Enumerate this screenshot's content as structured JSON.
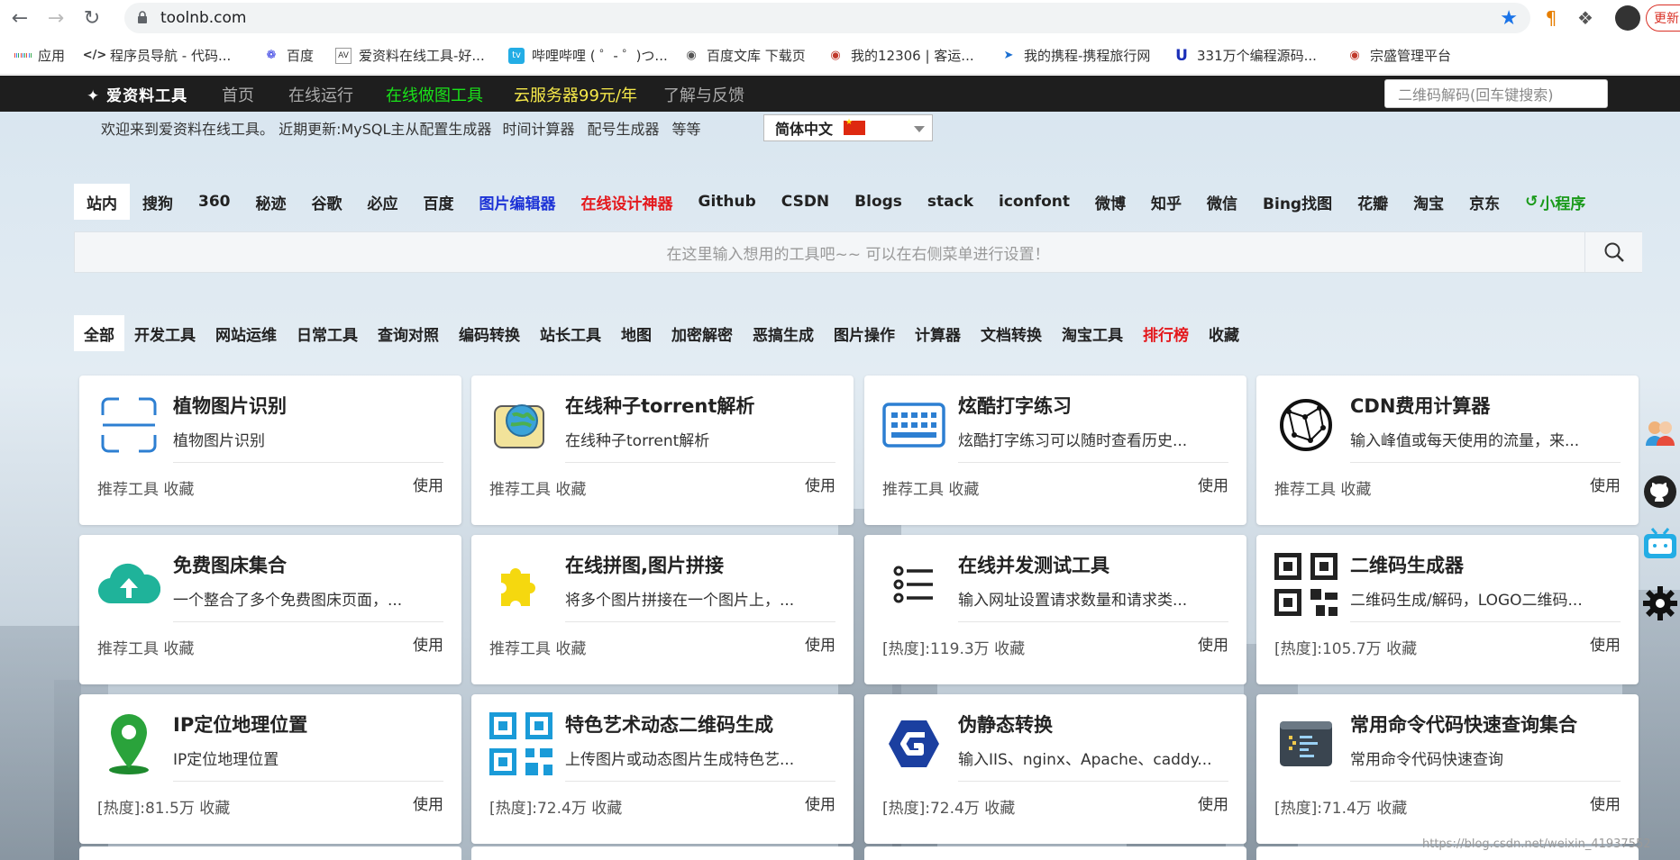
{
  "browser": {
    "url": "toolnb.com",
    "update_label": "更新"
  },
  "bookmarks": [
    {
      "label": "应用",
      "icon": "apps-grid-icon"
    },
    {
      "label": "程序员导航 - 代码...",
      "icon": "code-icon"
    },
    {
      "label": "百度",
      "icon": "baidu-paw-icon"
    },
    {
      "label": "爱资料在线工具-好...",
      "icon": "toolnb-icon"
    },
    {
      "label": "哔哩哔哩 ( ゜- ゜)つ...",
      "icon": "bilibili-icon"
    },
    {
      "label": "百度文库 下载页",
      "icon": "globe-icon"
    },
    {
      "label": "我的12306 | 客运...",
      "icon": "train-icon"
    },
    {
      "label": "我的携程-携程旅行网",
      "icon": "ctrip-icon"
    },
    {
      "label": "331万个编程源码...",
      "icon": "u-icon"
    },
    {
      "label": "宗盛管理平台",
      "icon": "platform-icon"
    }
  ],
  "site_header": {
    "logo": "爱资料工具",
    "nav": [
      {
        "label": "首页",
        "style": "normal"
      },
      {
        "label": "在线运行",
        "style": "normal"
      },
      {
        "label": "在线做图工具",
        "style": "green"
      },
      {
        "label": "云服务器99元/年",
        "style": "yellow"
      },
      {
        "label": "了解与反馈",
        "style": "normal"
      }
    ],
    "search_placeholder": "二维码解码(回车键搜索)"
  },
  "welcome": {
    "text": "欢迎来到爱资料在线工具。 近期更新: ",
    "updates": [
      "MySQL主从配置生成器",
      "时间计算器",
      "配号生成器",
      "等等"
    ],
    "language": "简体中文"
  },
  "engine_tabs": [
    {
      "label": "站内",
      "style": "active"
    },
    {
      "label": "搜狗",
      "style": "normal"
    },
    {
      "label": "360",
      "style": "normal"
    },
    {
      "label": "秘迹",
      "style": "normal"
    },
    {
      "label": "谷歌",
      "style": "normal"
    },
    {
      "label": "必应",
      "style": "normal"
    },
    {
      "label": "百度",
      "style": "normal"
    },
    {
      "label": "图片编辑器",
      "style": "blue"
    },
    {
      "label": "在线设计神器",
      "style": "red"
    },
    {
      "label": "Github",
      "style": "normal"
    },
    {
      "label": "CSDN",
      "style": "normal"
    },
    {
      "label": "Blogs",
      "style": "normal"
    },
    {
      "label": "stack",
      "style": "normal"
    },
    {
      "label": "iconfont",
      "style": "normal"
    },
    {
      "label": "微博",
      "style": "normal"
    },
    {
      "label": "知乎",
      "style": "normal"
    },
    {
      "label": "微信",
      "style": "normal"
    },
    {
      "label": "Bing找图",
      "style": "normal"
    },
    {
      "label": "花瓣",
      "style": "normal"
    },
    {
      "label": "淘宝",
      "style": "normal"
    },
    {
      "label": "京东",
      "style": "normal"
    },
    {
      "label": "小程序",
      "style": "green"
    }
  ],
  "main_search": {
    "placeholder": "在这里输入想用的工具吧~~ 可以在右侧菜单进行设置！"
  },
  "category_tabs": [
    {
      "label": "全部",
      "style": "active"
    },
    {
      "label": "开发工具",
      "style": "normal"
    },
    {
      "label": "网站运维",
      "style": "normal"
    },
    {
      "label": "日常工具",
      "style": "normal"
    },
    {
      "label": "查询对照",
      "style": "normal"
    },
    {
      "label": "编码转换",
      "style": "normal"
    },
    {
      "label": "站长工具",
      "style": "normal"
    },
    {
      "label": "地图",
      "style": "normal"
    },
    {
      "label": "加密解密",
      "style": "normal"
    },
    {
      "label": "恶搞生成",
      "style": "normal"
    },
    {
      "label": "图片操作",
      "style": "normal"
    },
    {
      "label": "计算器",
      "style": "normal"
    },
    {
      "label": "文档转换",
      "style": "normal"
    },
    {
      "label": "淘宝工具",
      "style": "normal"
    },
    {
      "label": "排行榜",
      "style": "red"
    },
    {
      "label": "收藏",
      "style": "normal"
    }
  ],
  "cards": [
    {
      "title": "植物图片识别",
      "desc": "植物图片识别",
      "meta": "推荐工具 收藏",
      "use": "使用",
      "icon": "scan-frame-icon"
    },
    {
      "title": "在线种子torrent解析",
      "desc": "在线种子torrent解析",
      "meta": "推荐工具 收藏",
      "use": "使用",
      "icon": "torrent-globe-icon"
    },
    {
      "title": "炫酷打字练习",
      "desc": "炫酷打字练习可以随时查看历史...",
      "meta": "推荐工具 收藏",
      "use": "使用",
      "icon": "keyboard-icon"
    },
    {
      "title": "CDN费用计算器",
      "desc": "输入峰值或每天使用的流量，来...",
      "meta": "推荐工具 收藏",
      "use": "使用",
      "icon": "network-globe-icon"
    },
    {
      "title": "免费图床集合",
      "desc": "一个整合了多个免费图床页面，...",
      "meta": "推荐工具 收藏",
      "use": "使用",
      "icon": "cloud-upload-icon"
    },
    {
      "title": "在线拼图,图片拼接",
      "desc": "将多个图片拼接在一个图片上，...",
      "meta": "推荐工具 收藏",
      "use": "使用",
      "icon": "puzzle-icon"
    },
    {
      "title": "在线并发测试工具",
      "desc": "输入网址设置请求数量和请求类...",
      "meta": "[热度]:119.3万 收藏",
      "use": "使用",
      "icon": "list-icon"
    },
    {
      "title": "二维码生成器",
      "desc": "二维码生成/解码，LOGO二维码...",
      "meta": "[热度]:105.7万 收藏",
      "use": "使用",
      "icon": "qrcode-icon"
    },
    {
      "title": "IP定位地理位置",
      "desc": "IP定位地理位置",
      "meta": "[热度]:81.5万 收藏",
      "use": "使用",
      "icon": "map-pin-icon"
    },
    {
      "title": "特色艺术动态二维码生成",
      "desc": "上传图片或动态图片生成特色艺...",
      "meta": "[热度]:72.4万 收藏",
      "use": "使用",
      "icon": "art-qrcode-icon"
    },
    {
      "title": "伪静态转换",
      "desc": "输入IIS、nginx、Apache、caddy...",
      "meta": "[热度]:72.4万 收藏",
      "use": "使用",
      "icon": "g-logo-icon"
    },
    {
      "title": "常用命令代码快速查询集合",
      "desc": "常用命令代码快速查询",
      "meta": "[热度]:71.4万 收藏",
      "use": "使用",
      "icon": "terminal-icon"
    }
  ],
  "watermark": "https://blog.csdn.net/weixin_41937552",
  "colors": {
    "header_bg": "#1e1e1e",
    "accent_green": "#19e319",
    "accent_yellow": "#f6e94a",
    "tab_red": "#e4181c",
    "tab_blue": "#1d33d6",
    "icon_blue": "#2d7fd2"
  }
}
